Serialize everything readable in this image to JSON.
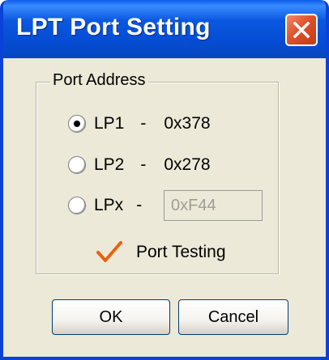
{
  "window": {
    "title": "LPT Port Setting"
  },
  "port_address": {
    "legend": "Port Address",
    "options": [
      {
        "label": "LP1",
        "dash": "-",
        "address": "0x378",
        "checked": true
      },
      {
        "label": "LP2",
        "dash": "-",
        "address": "0x278",
        "checked": false
      },
      {
        "label": "LPx",
        "dash": "-",
        "address_value": "0xF44",
        "checked": false
      }
    ]
  },
  "port_testing": {
    "label": "Port Testing",
    "checked": true
  },
  "buttons": {
    "ok": "OK",
    "cancel": "Cancel"
  },
  "icons": {
    "close": "close-icon",
    "check": "check-icon"
  },
  "colors": {
    "titlebar": "#0b58e0",
    "close_button": "#e0512b",
    "dialog_bg": "#ece9d8",
    "check": "#e8620e"
  }
}
